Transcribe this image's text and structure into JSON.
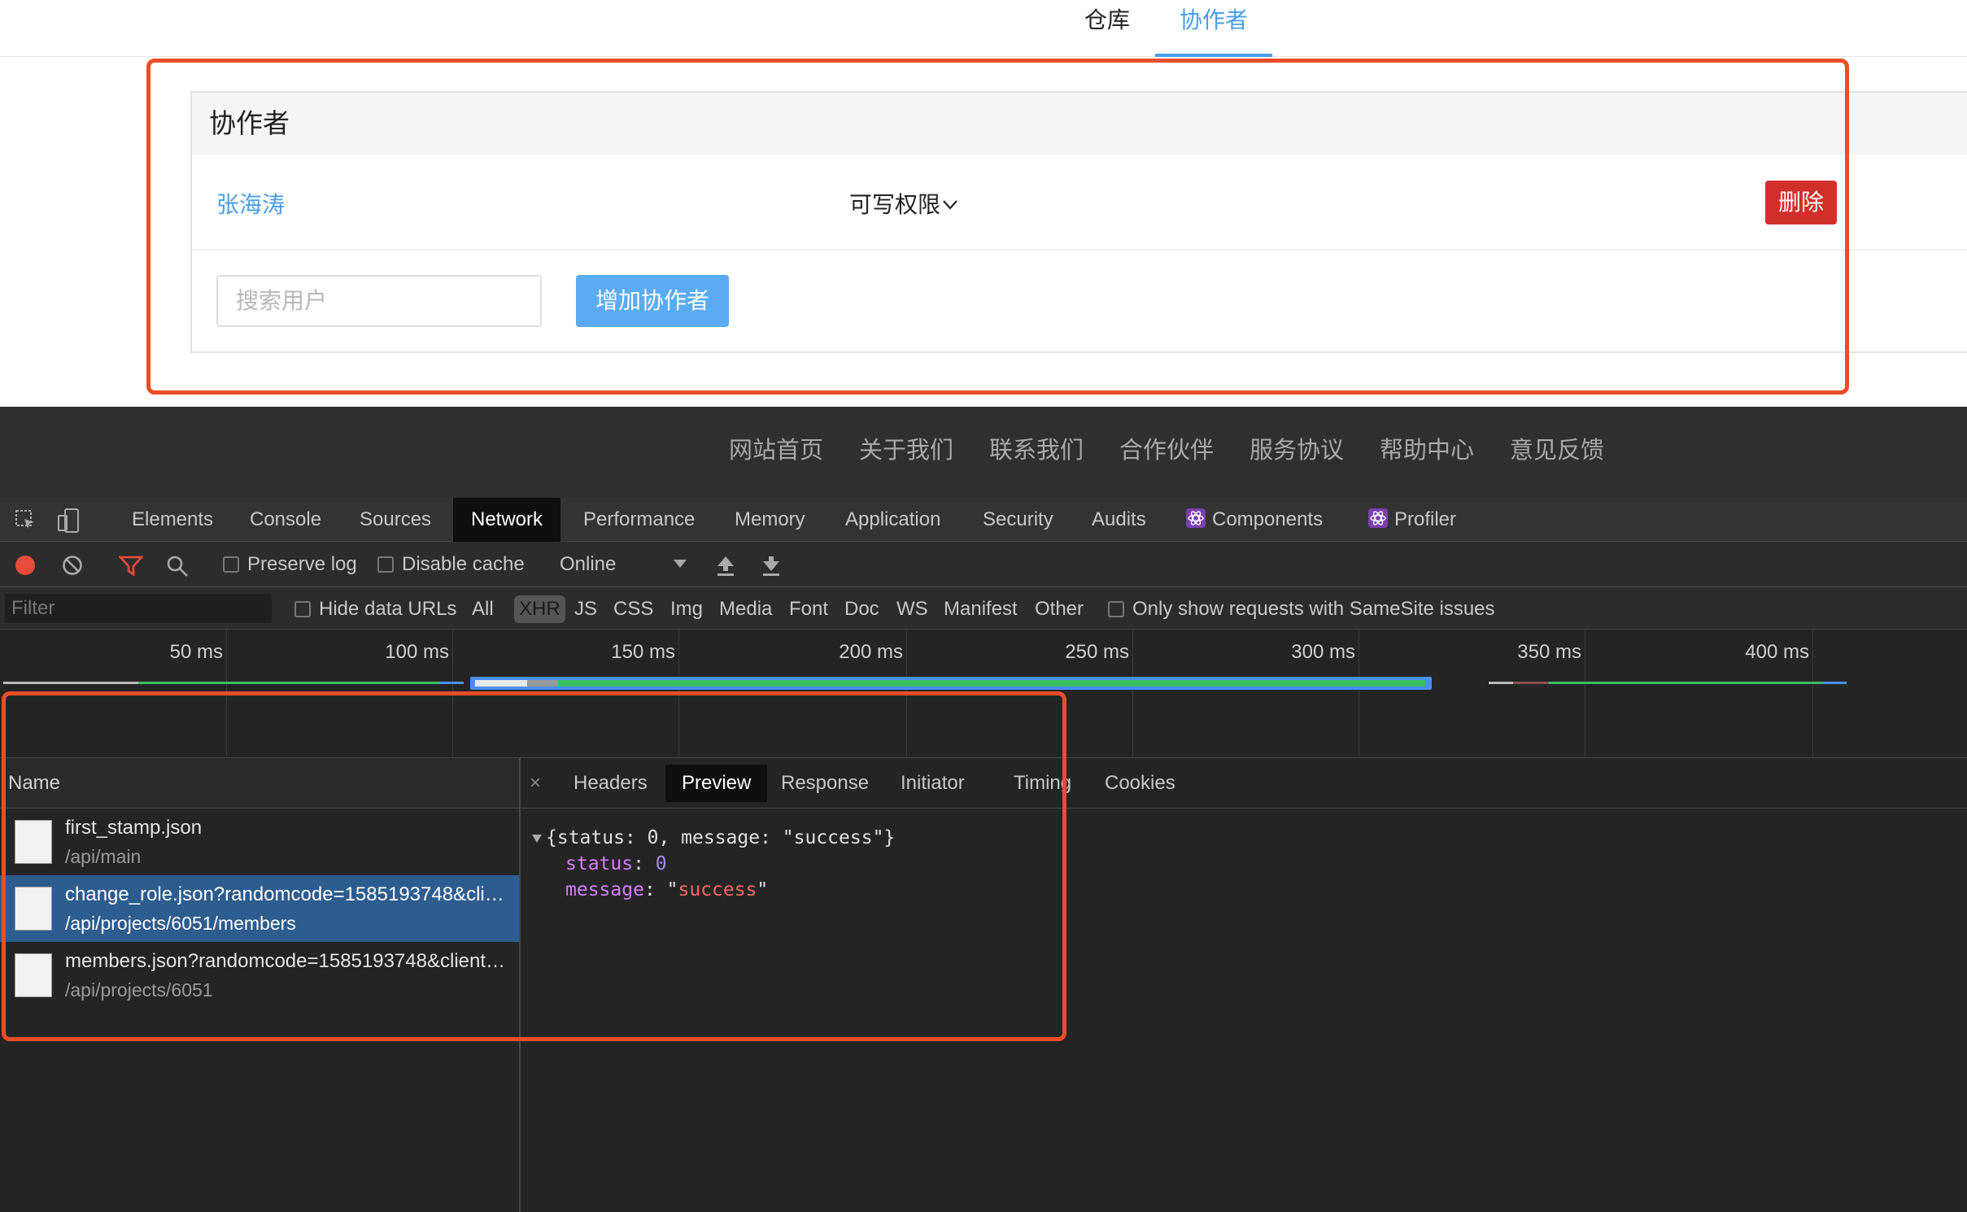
{
  "web": {
    "top_tabs": [
      "仓库",
      "协作者"
    ],
    "panel_title": "协作者",
    "member": {
      "name": "张海涛",
      "role": "可写权限",
      "delete_label": "删除"
    },
    "search_placeholder": "搜索用户",
    "add_button": "增加协作者"
  },
  "footer": [
    "网站首页",
    "关于我们",
    "联系我们",
    "合作伙伴",
    "服务协议",
    "帮助中心",
    "意见反馈"
  ],
  "devtools": {
    "tabs": [
      "Elements",
      "Console",
      "Sources",
      "Network",
      "Performance",
      "Memory",
      "Application",
      "Security",
      "Audits",
      "Components",
      "Profiler"
    ],
    "active_tab": "Network",
    "toolbar": {
      "preserve_log": "Preserve log",
      "disable_cache": "Disable cache",
      "throttle": "Online"
    },
    "filter": {
      "placeholder": "Filter",
      "hide_data_urls": "Hide data URLs",
      "types": [
        "All",
        "XHR",
        "JS",
        "CSS",
        "Img",
        "Media",
        "Font",
        "Doc",
        "WS",
        "Manifest",
        "Other"
      ],
      "selected_type": "XHR",
      "samesite": "Only show requests with SameSite issues"
    },
    "timeline_ticks": [
      "50 ms",
      "100 ms",
      "150 ms",
      "200 ms",
      "250 ms",
      "300 ms",
      "350 ms",
      "400 ms"
    ],
    "names_header": "Name",
    "requests": [
      {
        "name": "first_stamp.json",
        "path": "/api/main"
      },
      {
        "name": "change_role.json?randomcode=1585193748&client=...",
        "path": "/api/projects/6051/members"
      },
      {
        "name": "members.json?randomcode=1585193748&client=...",
        "path": "/api/projects/6051"
      }
    ],
    "detail_tabs": [
      "×",
      "Headers",
      "Preview",
      "Response",
      "Initiator",
      "Timing",
      "Cookies"
    ],
    "active_detail": "Preview",
    "preview": {
      "summary": "{status: 0, message: \"success\"}",
      "status_key": "status",
      "status_val": "0",
      "message_key": "message",
      "message_val": "success"
    }
  },
  "colors": {
    "accent": "#4a9ee8",
    "danger": "#d1302a",
    "highlight": "#eb4e27",
    "selected_row": "#2d5c8e"
  }
}
